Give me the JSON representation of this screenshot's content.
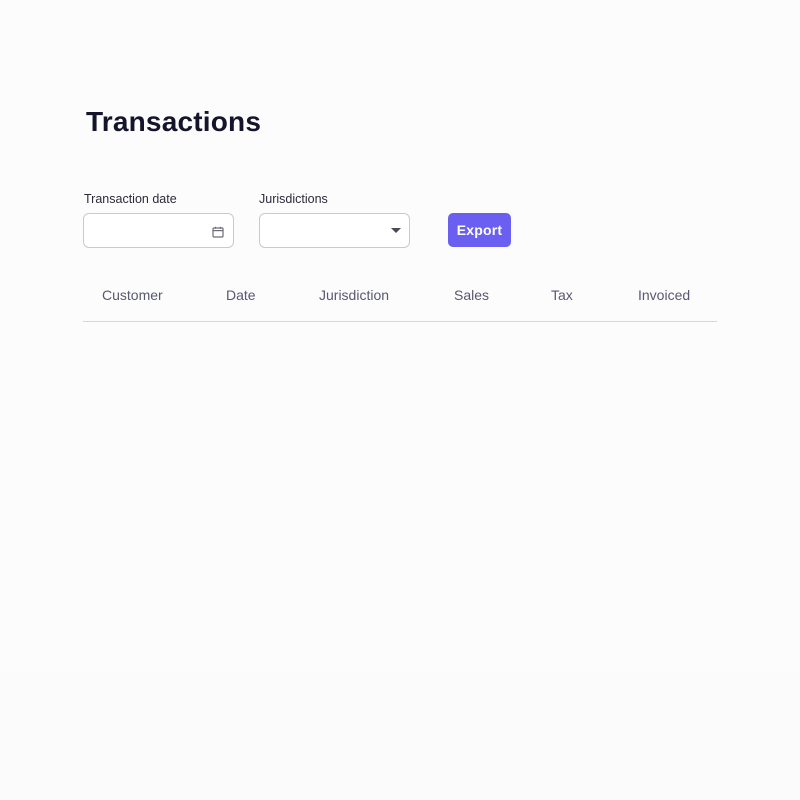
{
  "page": {
    "title": "Transactions"
  },
  "filters": {
    "transaction_date": {
      "label": "Transaction date",
      "value": "",
      "icon": "calendar-icon"
    },
    "jurisdictions": {
      "label": "Jurisdictions",
      "selected": "",
      "icon": "chevron-down-icon"
    }
  },
  "toolbar": {
    "export_label": "Export",
    "accent_color": "#6a5ff0"
  },
  "table": {
    "columns": [
      "Customer",
      "Date",
      "Jurisdiction",
      "Sales",
      "Tax",
      "Invoiced"
    ],
    "rows": []
  }
}
